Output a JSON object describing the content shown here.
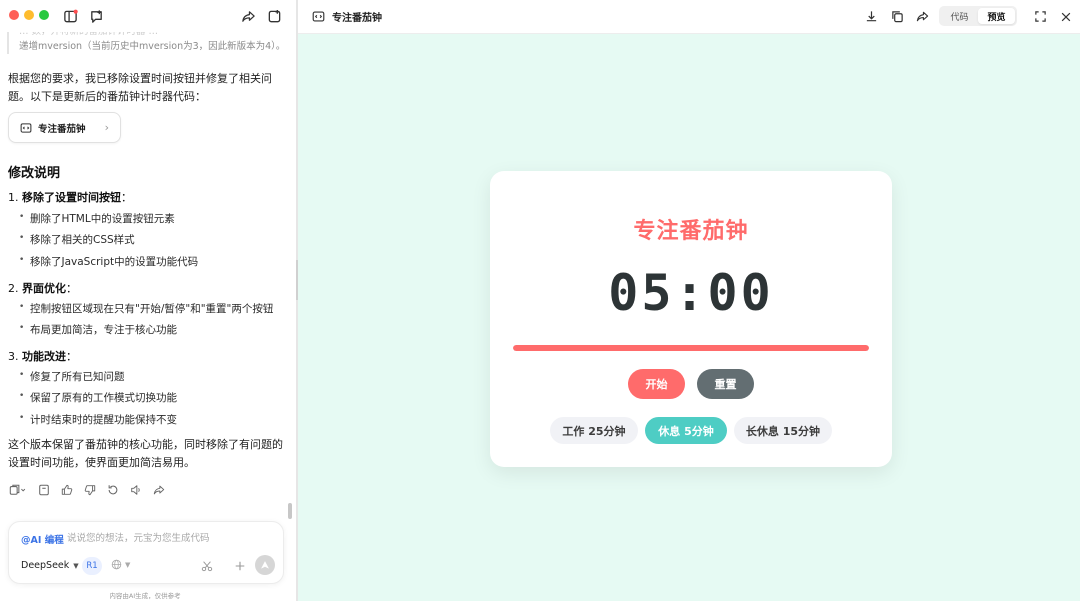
{
  "chat": {
    "truncated_line1": "… 数，并将新的番茄钟计时器 …",
    "truncated_line2": "递增mversion（当前历史中mversion为3，因此新版本为4）。",
    "intro_line1": "根据您的要求，我已移除设置时间按钮并修复了相关问",
    "intro_line2": "题。以下是更新后的番茄钟计时器代码：",
    "artifact_card_label": "专注番茄钟",
    "section_title": "修改说明",
    "sections": [
      {
        "head_num": "1.",
        "head_text": "移除了设置时间按钮",
        "head_colon": "：",
        "bullets": [
          "删除了HTML中的设置按钮元素",
          "移除了相关的CSS样式",
          "移除了JavaScript中的设置功能代码"
        ]
      },
      {
        "head_num": "2.",
        "head_text": "界面优化",
        "head_colon": "：",
        "bullets": [
          "控制按钮区域现在只有\"开始/暂停\"和\"重置\"两个按钮",
          "布局更加简洁，专注于核心功能"
        ]
      },
      {
        "head_num": "3.",
        "head_text": "功能改进",
        "head_colon": "：",
        "bullets": [
          "修复了所有已知问题",
          "保留了原有的工作模式切换功能",
          "计时结束时的提醒功能保持不变"
        ]
      }
    ],
    "outro_line1": "这个版本保留了番茄钟的核心功能，同时移除了有问题的",
    "outro_line2": "设置时间功能，使界面更加简洁易用。"
  },
  "composer": {
    "ai_tag": "@AI 编程",
    "placeholder": "说说您的想法，元宝为您生成代码",
    "model": "DeepSeek",
    "r1_label": "R1"
  },
  "disclaimer": "内容由AI生成，仅供参考",
  "preview": {
    "title": "专注番茄钟",
    "tab_code": "代码",
    "tab_preview": "预览",
    "active_tab": "preview"
  },
  "pomodoro": {
    "title": "专注番茄钟",
    "timer": "05:00",
    "progress": 1.0,
    "start_label": "开始",
    "reset_label": "重置",
    "modes": [
      {
        "label": "工作 25分钟",
        "active": false
      },
      {
        "label": "休息 5分钟",
        "active": true
      },
      {
        "label": "长休息 15分钟",
        "active": false
      }
    ]
  },
  "colors": {
    "accent_red": "#ff6b6b",
    "accent_teal": "#4ecdc4",
    "reset_gray": "#636e72",
    "preview_bg": "#e6faf3",
    "link_blue": "#3b73e6"
  },
  "icons": {
    "titlebar": [
      "sidebar-toggle-icon",
      "new-chat-icon",
      "share-icon",
      "new-window-icon"
    ],
    "actions": [
      "copy-icon",
      "bookmark-icon",
      "thumbs-up-icon",
      "thumbs-down-icon",
      "regenerate-icon",
      "read-aloud-icon",
      "share-icon"
    ],
    "preview_toolbar": [
      "download-icon",
      "copy-icon",
      "share-icon",
      "fullscreen-icon",
      "close-icon"
    ]
  }
}
